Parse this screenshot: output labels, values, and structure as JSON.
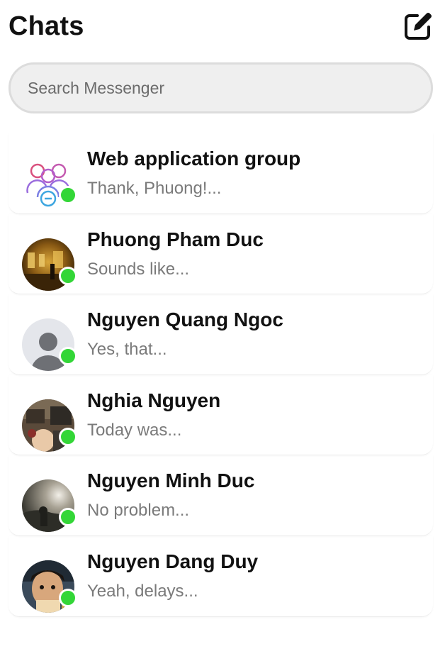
{
  "header": {
    "title": "Chats",
    "compose_icon": "compose-edit-icon"
  },
  "search": {
    "placeholder": "Search Messenger",
    "value": ""
  },
  "colors": {
    "online": "#33d637",
    "preview_text": "#7a7a7a",
    "search_bg": "#efefef"
  },
  "chats": [
    {
      "name": "Web application group",
      "preview": "Thank, Phuong!...",
      "online": true,
      "avatar": "group-icon"
    },
    {
      "name": "Phuong Pham Duc",
      "preview": "Sounds like...",
      "online": true,
      "avatar": "photo-avatar"
    },
    {
      "name": "Nguyen Quang Ngoc",
      "preview": "Yes, that...",
      "online": true,
      "avatar": "default-user-icon"
    },
    {
      "name": "Nghia Nguyen",
      "preview": "Today was...",
      "online": true,
      "avatar": "photo-avatar"
    },
    {
      "name": "Nguyen Minh Duc",
      "preview": "No problem...",
      "online": true,
      "avatar": "photo-avatar"
    },
    {
      "name": "Nguyen Dang Duy",
      "preview": "Yeah, delays...",
      "online": true,
      "avatar": "photo-avatar"
    }
  ]
}
